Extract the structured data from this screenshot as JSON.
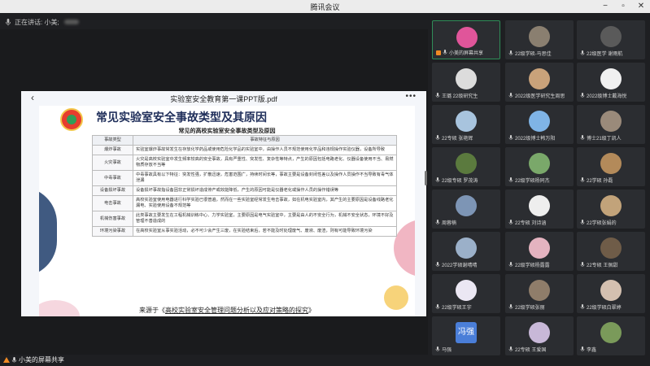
{
  "window": {
    "title": "腾讯会议"
  },
  "speaker": {
    "label": "正在讲话: 小美;"
  },
  "viewer": {
    "doc_title": "实验室安全教育第一课PPT版.pdf",
    "more": "•••"
  },
  "slide": {
    "title": "常见实验室安全事故类型及其原因",
    "table_title": "常见的高校实验室安全事故类型及原因",
    "headers": [
      "事故类型",
      "事故特征与原因"
    ],
    "rows": [
      {
        "type": "爆炸事故",
        "desc": "实验室爆炸事故常发生在存放化学药品或使用危险化学品的实验室中，由操作人员不规范使用化学品和违规操作实验仪器，设备所导致"
      },
      {
        "type": "火灾事故",
        "desc": "火灾是高校实验室中发生频率较高的安全事故，具有严重性、突发性、复杂性等特点，产生的原因包括电路老化、仪器设备使用不当、易燃物质存放不当等"
      },
      {
        "type": "中毒事故",
        "desc": "中毒事故具有以下特征：突发性强，扩散迅速，危害范围广，持续时间长等，事故主要是设备封闭性差以及操作人员操作不当导致有毒气体泄漏"
      },
      {
        "type": "设备损坏事故",
        "desc": "设备损坏事故指设备因非正常损坏造成停产或效能降低，产生的原因可能是仪器老化或操作人员的操作错误等"
      },
      {
        "type": "电击事故",
        "desc": "高校实验室使用电器进行科学实验已很普遍，然而在一些实验室经常发生电击事故，如在机电实验室内，其产生的主要原因是设备线路老化漏电、实验使用设备不规范等"
      },
      {
        "type": "机械伤害事故",
        "desc": "此类事故主要发生在工程机械训练中心、力学实验室，主要原因是电气实验室中，主要是由人的不安全行为，机械不安全状态，环境不好及管理不善造成的"
      },
      {
        "type": "环境污染事故",
        "desc": "在高校实验室从事实验活动，必不可少会产生三废，在实验结束后，若不能及时处理废气、废液、废渣，则有可能导致环境污染"
      }
    ],
    "source_prefix": "来源于《",
    "source_link": "高校实验室安全管理问题分析以及应对策略的探究",
    "source_suffix": "》"
  },
  "bottom": {
    "share_label": "小美的屏幕共享"
  },
  "participants": [
    {
      "name": "小美的屏幕共享",
      "color": "#e0559a",
      "active": true,
      "badge": true
    },
    {
      "name": "22级学硕-马思佳",
      "color": "#8a7f70"
    },
    {
      "name": "22级医学 谢雨航",
      "color": "#5a5a5a"
    },
    {
      "name": "王璐 22级研究生",
      "color": "#dcdcdc"
    },
    {
      "name": "2022级医学研究生周思",
      "color": "#c9a27a"
    },
    {
      "name": "2022级博士戴海悦",
      "color": "#f0f0f0"
    },
    {
      "name": "22专硕 张艳辉",
      "color": "#a8c4de"
    },
    {
      "name": "2022级博士韩万阳",
      "color": "#7fb4e6"
    },
    {
      "name": "博士21级丁凯人",
      "color": "#9a8a7a"
    },
    {
      "name": "22级专硕 罗茂涛",
      "color": "#5b7a3e"
    },
    {
      "name": "22级学硕杨同杰",
      "color": "#7aa86a"
    },
    {
      "name": "22学硕 孙磊",
      "color": "#b38a5a"
    },
    {
      "name": "周蓉楠",
      "color": "#7d95b5"
    },
    {
      "name": "22专硕 刘诗涵",
      "color": "#eeeeee"
    },
    {
      "name": "22学硕张娟的",
      "color": "#c2a37a"
    },
    {
      "name": "2022学硕谢晴晴",
      "color": "#9bb0c9"
    },
    {
      "name": "22级学硕杨露露",
      "color": "#e4b3c0"
    },
    {
      "name": "22专硕 王佩甜",
      "color": "#6f5c48"
    },
    {
      "name": "22级学硕王宇",
      "color": "#ebe7f3"
    },
    {
      "name": "22级学硕张丽",
      "color": "#8f7d6a"
    },
    {
      "name": "22级学硕白翠婷",
      "color": "#d4c0b0"
    },
    {
      "name": "马强",
      "color": "#4a7ed8",
      "text": "冯强"
    },
    {
      "name": "22专硕 王爱国",
      "color": "#c8b8d8"
    },
    {
      "name": "李鑫",
      "color": "#7a9a5a"
    }
  ]
}
